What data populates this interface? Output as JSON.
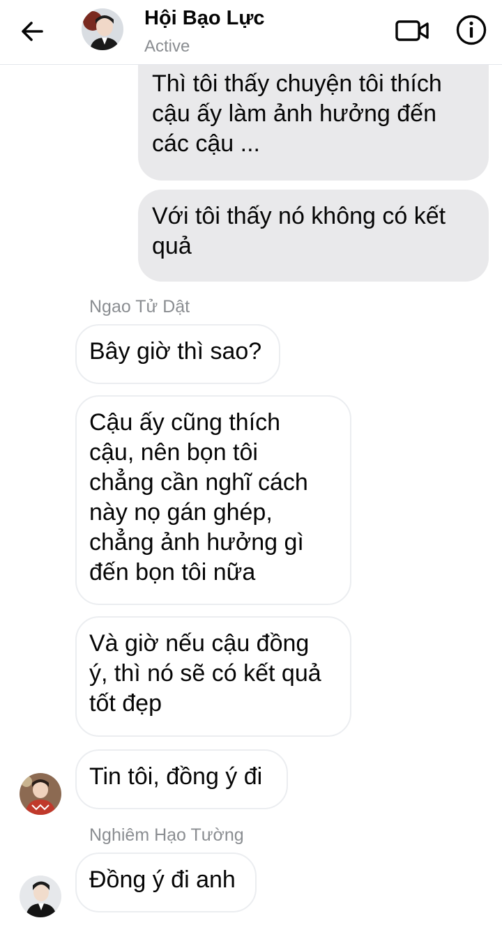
{
  "header": {
    "title": "Hội Bạo Lực",
    "status": "Active"
  },
  "colors": {
    "outgoing_bubble": "#e9e9eb",
    "incoming_border": "#ebedf0",
    "icon": "#050505",
    "secondary_text": "#8a8d91"
  },
  "icons": [
    "back-arrow-icon",
    "video-call-icon",
    "info-icon"
  ],
  "messages": [
    {
      "direction": "outgoing",
      "text": "Thì tôi thấy chuyện tôi thích\ncậu ấy làm ảnh hưởng đến\ncác cậu ..."
    },
    {
      "direction": "outgoing",
      "text": "Với tôi thấy nó không có kết\nquả"
    },
    {
      "direction": "incoming",
      "sender": "Ngao Tử Dật",
      "text": "Bây giờ thì sao?"
    },
    {
      "direction": "incoming",
      "text": "Cậu ấy cũng thích\ncậu, nên bọn tôi\nchẳng cần nghĩ cách\nnày nọ gán ghép,\nchẳng ảnh hưởng gì\nđến bọn tôi nữa"
    },
    {
      "direction": "incoming",
      "text": "Và giờ nếu cậu đồng\ný, thì nó sẽ có kết quả\ntốt đẹp"
    },
    {
      "direction": "incoming",
      "text": "Tin tôi, đồng ý đi"
    },
    {
      "direction": "incoming",
      "sender": "Nghiêm Hạo Tường",
      "text": "Đồng ý đi anh"
    }
  ]
}
